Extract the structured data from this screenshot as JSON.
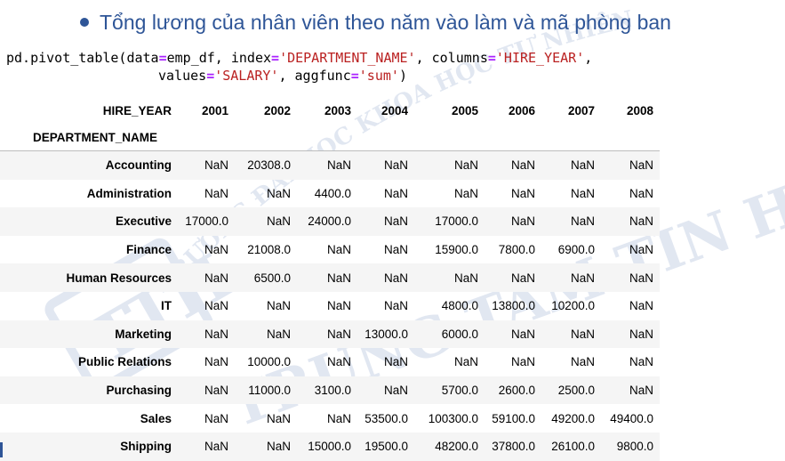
{
  "title": "Tổng lương của nhân viên theo năm vào làm và mã phòng ban",
  "code": {
    "line1_fn": "pd.pivot_table(data",
    "line1_eq1": "=",
    "line1_arg1": "emp_df, index",
    "line1_eq2": "=",
    "line1_str1": "'DEPARTMENT_NAME'",
    "line1_arg2": ", columns",
    "line1_eq3": "=",
    "line1_str2": "'HIRE_YEAR'",
    "line1_end": ",",
    "line2_arg1": "values",
    "line2_eq1": "=",
    "line2_str1": "'SALARY'",
    "line2_arg2": ", aggfunc",
    "line2_eq2": "=",
    "line2_str2": "'sum'",
    "line2_end": ")"
  },
  "table": {
    "columns_label": "HIRE_YEAR",
    "index_label": "DEPARTMENT_NAME",
    "years": [
      "2001",
      "2002",
      "2003",
      "2004",
      "2005",
      "2006",
      "2007",
      "2008"
    ],
    "rows": [
      {
        "name": "Accounting",
        "values": [
          "NaN",
          "20308.0",
          "NaN",
          "NaN",
          "NaN",
          "NaN",
          "NaN",
          "NaN"
        ]
      },
      {
        "name": "Administration",
        "values": [
          "NaN",
          "NaN",
          "4400.0",
          "NaN",
          "NaN",
          "NaN",
          "NaN",
          "NaN"
        ]
      },
      {
        "name": "Executive",
        "values": [
          "17000.0",
          "NaN",
          "24000.0",
          "NaN",
          "17000.0",
          "NaN",
          "NaN",
          "NaN"
        ]
      },
      {
        "name": "Finance",
        "values": [
          "NaN",
          "21008.0",
          "NaN",
          "NaN",
          "15900.0",
          "7800.0",
          "6900.0",
          "NaN"
        ]
      },
      {
        "name": "Human Resources",
        "values": [
          "NaN",
          "6500.0",
          "NaN",
          "NaN",
          "NaN",
          "NaN",
          "NaN",
          "NaN"
        ]
      },
      {
        "name": "IT",
        "values": [
          "NaN",
          "NaN",
          "NaN",
          "NaN",
          "4800.0",
          "13800.0",
          "10200.0",
          "NaN"
        ]
      },
      {
        "name": "Marketing",
        "values": [
          "NaN",
          "NaN",
          "NaN",
          "13000.0",
          "6000.0",
          "NaN",
          "NaN",
          "NaN"
        ]
      },
      {
        "name": "Public Relations",
        "values": [
          "NaN",
          "10000.0",
          "NaN",
          "NaN",
          "NaN",
          "NaN",
          "NaN",
          "NaN"
        ]
      },
      {
        "name": "Purchasing",
        "values": [
          "NaN",
          "11000.0",
          "3100.0",
          "NaN",
          "5700.0",
          "2600.0",
          "2500.0",
          "NaN"
        ]
      },
      {
        "name": "Sales",
        "values": [
          "NaN",
          "NaN",
          "NaN",
          "53500.0",
          "100300.0",
          "59100.0",
          "49200.0",
          "49400.0"
        ]
      },
      {
        "name": "Shipping",
        "values": [
          "NaN",
          "NaN",
          "15000.0",
          "19500.0",
          "48200.0",
          "37800.0",
          "26100.0",
          "9800.0"
        ]
      }
    ]
  },
  "watermark": {
    "arc_text": "TRƯỜNG ĐẠI HỌC KHOA HỌC TỰ NHIÊN",
    "big_text": "TRUNG TÂM TIN HỌC",
    "logo_text": "TTH",
    "color": "#c9d3e6"
  },
  "colors": {
    "title": "#2e5597",
    "string": "#ba2121",
    "operator": "#aa22ff",
    "row_stripe": "#f5f5f5"
  }
}
